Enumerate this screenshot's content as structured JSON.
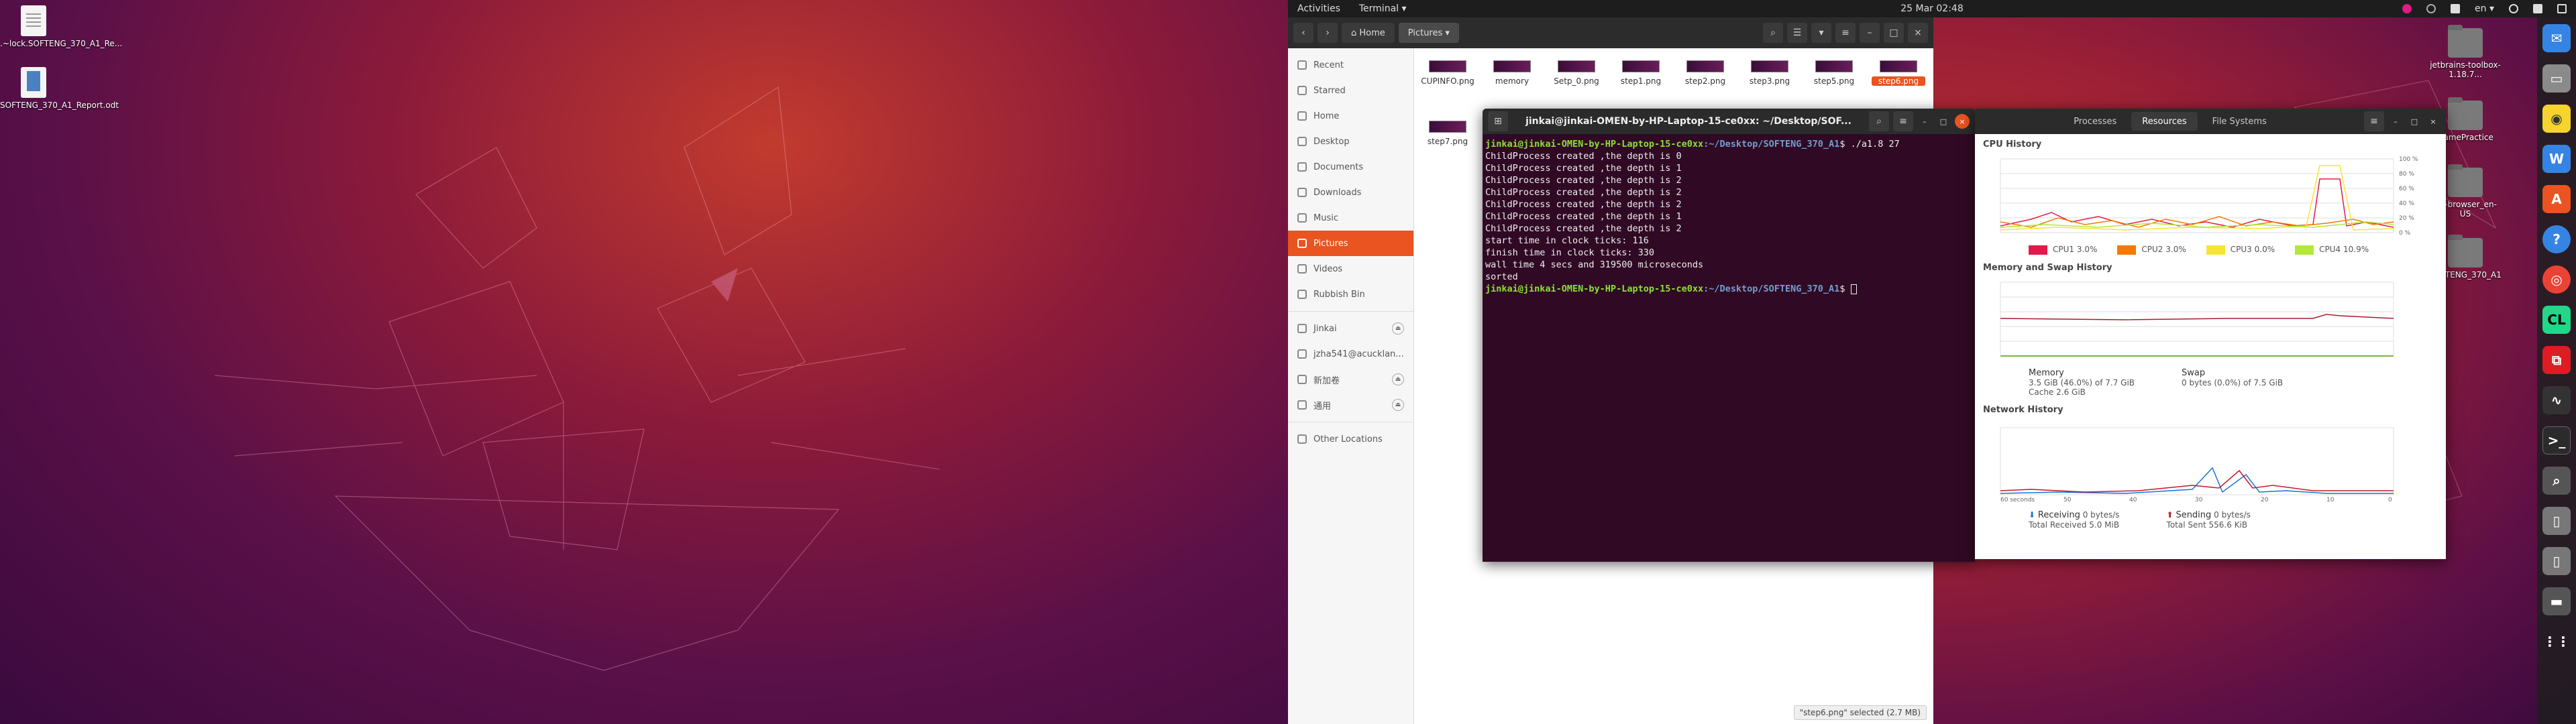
{
  "left_desktop": {
    "icons": [
      {
        "label": ".~lock.SOFTENG_370_A1_Re..."
      },
      {
        "label": "SOFTENG_370_A1_Report.odt"
      }
    ]
  },
  "topbar": {
    "activities": "Activities",
    "app_menu": "Terminal ▾",
    "clock": "25 Mar  02:48",
    "lang": "en ▾"
  },
  "files": {
    "breadcrumb": [
      "Home",
      "Pictures"
    ],
    "sidebar": [
      "Recent",
      "Starred",
      "Home",
      "Desktop",
      "Documents",
      "Downloads",
      "Music",
      "Pictures",
      "Videos",
      "Rubbish Bin"
    ],
    "devices": [
      "Jinkai",
      "jzha541@acucklan...",
      "新加卷",
      "通用"
    ],
    "other": "Other Locations",
    "thumbs": [
      {
        "name": "CUPINFO.png"
      },
      {
        "name": "memory"
      },
      {
        "name": "Setp_0.png"
      },
      {
        "name": "step1.png"
      },
      {
        "name": "step2.png"
      },
      {
        "name": "step3.png"
      },
      {
        "name": "step5.png"
      },
      {
        "name": "step6.png"
      },
      {
        "name": "step7.png"
      }
    ],
    "status": "\"step6.png\" selected  (2.7 MB)"
  },
  "terminal": {
    "title": "jinkai@jinkai-OMEN-by-HP-Laptop-15-ce0xx: ~/Desktop/SOF...",
    "prompt_user": "jinkai@jinkai-OMEN-by-HP-Laptop-15-ce0xx",
    "prompt_path": ":~/Desktop/SOFTENG_370_A1",
    "command": "$ ./a1.8 27",
    "lines": [
      "ChildProcess created ,the depth is 0",
      "ChildProcess created ,the depth is 1",
      "ChildProcess created ,the depth is 2",
      "ChildProcess created ,the depth is 2",
      "ChildProcess created ,the depth is 2",
      "ChildProcess created ,the depth is 1",
      "ChildProcess created ,the depth is 2",
      "start time in clock ticks: 116",
      "finish time in clock ticks: 330",
      "wall time 4 secs and 319500 microseconds",
      "sorted"
    ],
    "prompt_end": "$ "
  },
  "sysmon": {
    "tabs": [
      "Processes",
      "Resources",
      "File Systems"
    ],
    "cpu_title": "CPU History",
    "cpu_legend": [
      {
        "name": "CPU1",
        "value": "3.0%",
        "color": "#e01b4b"
      },
      {
        "name": "CPU2",
        "value": "3.0%",
        "color": "#f57900"
      },
      {
        "name": "CPU3",
        "value": "0.0%",
        "color": "#f8e436"
      },
      {
        "name": "CPU4",
        "value": "10.9%",
        "color": "#b2e83a"
      }
    ],
    "mem_title": "Memory and Swap History",
    "memory": {
      "label": "Memory",
      "detail": "3.5 GiB (46.0%) of 7.7 GiB",
      "cache": "Cache 2.6 GiB"
    },
    "swap": {
      "label": "Swap",
      "detail": "0 bytes (0.0%) of 7.5 GiB"
    },
    "net_title": "Network History",
    "receiving": {
      "label": "Receiving",
      "total_label": "Total Received",
      "rate": "0 bytes/s",
      "total": "5.0 MiB"
    },
    "sending": {
      "label": "Sending",
      "total_label": "Total Sent",
      "rate": "0 bytes/s",
      "total": "556.6 KiB"
    },
    "cpu_axis": [
      "100 %",
      "80 %",
      "60 %",
      "40 %",
      "20 %",
      "0 %"
    ],
    "x_axis": [
      "60 seconds",
      "50",
      "40",
      "30",
      "20",
      "10",
      "0"
    ]
  },
  "right_desktop": {
    "folders": [
      "jetbrains-toolbox-1.18.7...",
      "GamePractice",
      "tor-browser_en-US",
      "SOFTENG_370_A1"
    ]
  },
  "dock": {
    "icons": [
      "mail-icon",
      "files-icon",
      "rhythmbox-icon",
      "writer-icon",
      "software-icon",
      "help-icon",
      "chrome-icon",
      "clion-icon",
      "screenshot-icon",
      "monitor-icon",
      "terminal-icon",
      "magnifier-icon",
      "usb-icon",
      "usb-icon-2",
      "disk-icon",
      "apps-grid-icon"
    ]
  }
}
